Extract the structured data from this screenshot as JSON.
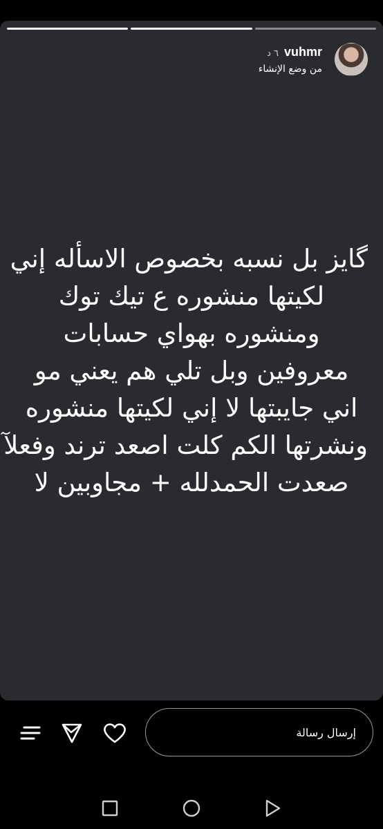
{
  "story": {
    "segments": [
      {
        "progress": 1.0
      },
      {
        "progress": 1.0
      },
      {
        "progress": 0.0
      }
    ],
    "user": {
      "username": "vuhmr",
      "time_ago": "٦ د",
      "subtitle": "من وضع الإنشاء"
    },
    "text_lines": [
      "گايز بل نسبه بخصوص الاسأله إني",
      "لكيتها منشوره ع تيك توك",
      "ومنشوره بهواي حسابات",
      "معروفين وبل تلي هم يعني مو",
      "اني جايبتها لا إني لكيتها منشوره",
      "ونشرتها الكم كلت اصعد ترند وفعلآ",
      "صعدت الحمدلله + مجاوبين لا"
    ],
    "text_color": "#ffffff",
    "background_color": "#2a2b2f"
  },
  "reply": {
    "placeholder": "إرسال رسالة"
  },
  "icons": {
    "like": "heart-icon",
    "share": "send-icon",
    "more": "menu-icon"
  },
  "system_nav": {
    "recents": "square-icon",
    "home": "circle-icon",
    "back": "triangle-back-icon"
  }
}
